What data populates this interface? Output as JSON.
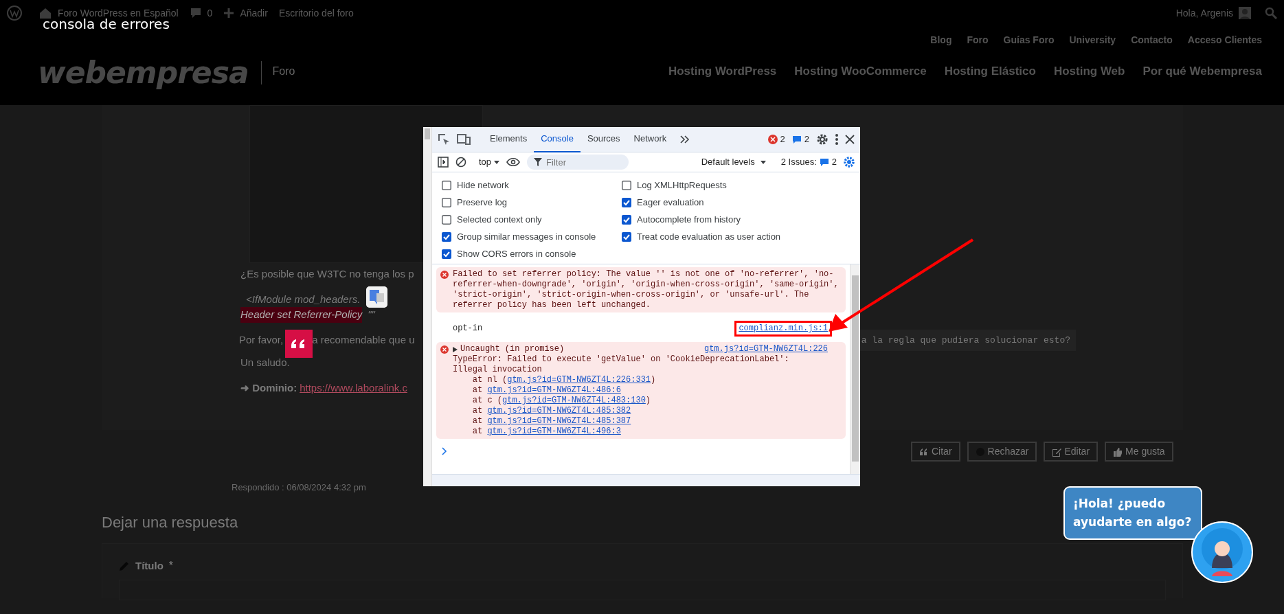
{
  "admin_bar": {
    "site_name": "Foro WordPress en Español",
    "comments": "0",
    "add": "Añadir",
    "dashboard": "Escritorio del foro",
    "greeting": "Hola, Argenis"
  },
  "caption": "consola de errores",
  "header": {
    "top_links": [
      "Blog",
      "Foro",
      "Guías Foro",
      "University",
      "Contacto",
      "Acceso Clientes"
    ],
    "logo": "webempresa",
    "section": "Foro",
    "nav": [
      "Hosting WordPress",
      "Hosting WooCommerce",
      "Hosting Elástico",
      "Hosting Web",
      "Por qué Webempresa"
    ]
  },
  "post": {
    "question": "¿Es posible que W3TC no tenga los p",
    "code_line_1": "<IfModule mod_headers.",
    "code_line_2": "Header set Referrer-Policy",
    "code_line_2_rest": "\"\"",
    "request_start": "Por favor,",
    "request_middle": "a recomendable que u",
    "request_code": "a la regla que pudiera solucionar esto?",
    "greeting": "Un saludo.",
    "domain_label": "➜ Dominio:",
    "domain_link": "https://www.laboralink.c",
    "actions": [
      "Citar",
      "Rechazar",
      "Editar",
      "Me gusta"
    ],
    "replied": "Respondido : 06/08/2024 4:32 pm"
  },
  "reply": {
    "heading": "Dejar una respuesta",
    "title_label": "Título",
    "required": "*"
  },
  "chat": {
    "message": "¡Hola! ¿puedo ayudarte en algo?"
  },
  "devtools": {
    "tabs": [
      {
        "label": "Elements",
        "selected": false
      },
      {
        "label": "Console",
        "selected": true
      },
      {
        "label": "Sources",
        "selected": false
      },
      {
        "label": "Network",
        "selected": false
      }
    ],
    "error_count": "2",
    "message_count": "2",
    "context": "top",
    "filter_placeholder": "Filter",
    "levels": "Default levels",
    "issues_label": "2 Issues:",
    "issues_count": "2",
    "settings_left": [
      {
        "label": "Hide network",
        "checked": false
      },
      {
        "label": "Preserve log",
        "checked": false
      },
      {
        "label": "Selected context only",
        "checked": false
      },
      {
        "label": "Group similar messages in console",
        "checked": true
      },
      {
        "label": "Show CORS errors in console",
        "checked": true
      }
    ],
    "settings_right": [
      {
        "label": "Log XMLHttpRequests",
        "checked": false
      },
      {
        "label": "Eager evaluation",
        "checked": true
      },
      {
        "label": "Autocomplete from history",
        "checked": true
      },
      {
        "label": "Treat code evaluation as user action",
        "checked": true
      }
    ],
    "console": [
      {
        "kind": "error",
        "text": "Failed to set referrer policy: The value '' is not one of 'no-referrer', 'no-referrer-when-downgrade', 'origin', 'origin-when-cross-origin', 'same-origin', 'strict-origin', 'strict-origin-when-cross-origin', or 'unsafe-url'. The referrer policy has been left unchanged."
      },
      {
        "kind": "log",
        "text": "opt-in",
        "source": "complianz.min.js:1",
        "highlighted": true
      },
      {
        "kind": "error",
        "summary": "Uncaught (in promise)",
        "expanded": false,
        "source": "gtm.js?id=GTM-NW6ZT4L:226",
        "text": "TypeError: Failed to execute 'getValue' on 'CookieDeprecationLabel':\nIllegal invocation",
        "stack": [
          {
            "text": "at nl (",
            "link": "gtm.js?id=GTM-NW6ZT4L:226:331",
            "suffix": ")"
          },
          {
            "text": "at ",
            "link": "gtm.js?id=GTM-NW6ZT4L:486:6"
          },
          {
            "text": "at c (",
            "link": "gtm.js?id=GTM-NW6ZT4L:483:130",
            "suffix": ")"
          },
          {
            "text": "at ",
            "link": "gtm.js?id=GTM-NW6ZT4L:485:382"
          },
          {
            "text": "at ",
            "link": "gtm.js?id=GTM-NW6ZT4L:485:387"
          },
          {
            "text": "at ",
            "link": "gtm.js?id=GTM-NW6ZT4L:496:3"
          }
        ]
      }
    ]
  }
}
